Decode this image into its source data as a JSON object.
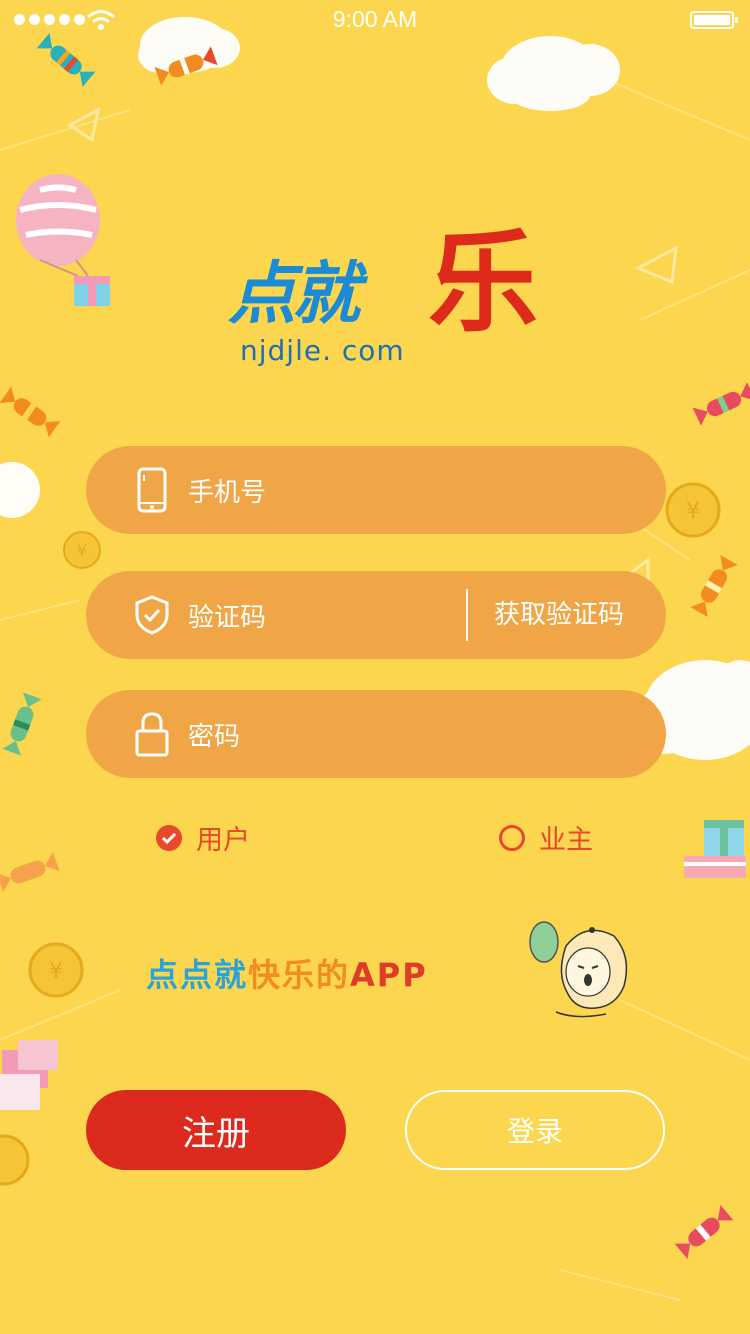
{
  "status_bar": {
    "time": "9:00 AM"
  },
  "logo": {
    "name_part": "点就",
    "name_accent": "乐",
    "domain": "njdjle. com"
  },
  "form": {
    "phone_label": "手机号",
    "code_label": "验证码",
    "get_code_label": "获取验证码",
    "password_label": "密码"
  },
  "roles": [
    {
      "label": "用户",
      "selected": true
    },
    {
      "label": "业主",
      "selected": false
    }
  ],
  "slogan": {
    "part1": "点点就",
    "part2": "快乐的",
    "part3": "APP"
  },
  "actions": {
    "register_label": "注册",
    "login_label": "登录"
  },
  "colors": {
    "background": "#fcd64e",
    "field": "#f0a646",
    "accent_red": "#dc2a1e",
    "radio": "#e8482c"
  }
}
